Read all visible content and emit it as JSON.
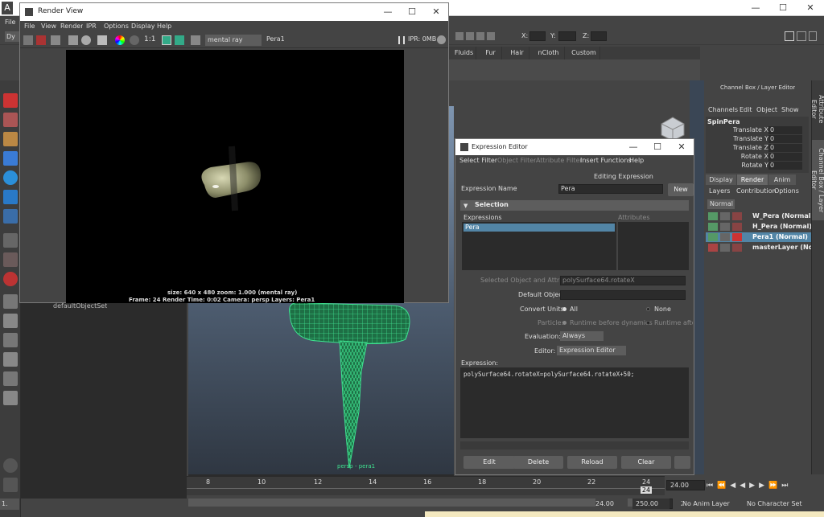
{
  "main_app": {
    "title_initial": "A",
    "menu_item": "File",
    "mode_menu": "Dy",
    "xyz": {
      "x_label": "X:",
      "y_label": "Y:",
      "z_label": "Z:"
    },
    "shelf_tabs": [
      "Fluids",
      "Fur",
      "Hair",
      "nCloth",
      "Custom"
    ],
    "outliner_item": "defaultObjectSet",
    "viewport_camera_label": "persp - pera1",
    "side_tabs": [
      "Attribute Editor",
      "Channel Box / Layer Editor"
    ]
  },
  "channel_box": {
    "title": "Channel Box / Layer Editor",
    "menu": [
      "Channels",
      "Edit",
      "Object",
      "Show"
    ],
    "object_name": "SpinPera",
    "attributes": [
      {
        "name": "Translate X",
        "value": "0"
      },
      {
        "name": "Translate Y",
        "value": "0"
      },
      {
        "name": "Translate Z",
        "value": "0"
      },
      {
        "name": "Rotate X",
        "value": "0"
      },
      {
        "name": "Rotate Y",
        "value": "0"
      }
    ],
    "layer_tabs": [
      "Display",
      "Render",
      "Anim"
    ],
    "layer_menu": [
      "Layers",
      "Contribution",
      "Options"
    ],
    "blend_mode": "Normal",
    "layers": [
      {
        "name": "W_Pera (Normal)",
        "selected": false
      },
      {
        "name": "H_Pera (Normal)",
        "selected": false
      },
      {
        "name": "Pera1 (Normal)",
        "selected": true
      },
      {
        "name": "masterLayer (Norm",
        "selected": false
      }
    ]
  },
  "timeline": {
    "ticks": [
      "8",
      "10",
      "12",
      "14",
      "16",
      "18",
      "20",
      "22",
      "24"
    ],
    "current_frame_marker": "24",
    "current_frame_box": "24.00",
    "range_start": "24.00",
    "range_end": "250.00",
    "anim_layer": "No Anim Layer",
    "character_set": "No Character Set",
    "left_field": "1."
  },
  "render_view": {
    "title": "Render View",
    "menu": [
      "File",
      "View",
      "Render",
      "IPR",
      "Options",
      "Display",
      "Help"
    ],
    "ratio_label": "1:1",
    "renderer": "mental ray",
    "layer": "Pera1",
    "ipr_status": "IPR: 0MB",
    "info_line1": "size: 640 x 480  zoom: 1.000          (mental ray)",
    "info_line2": "Frame: 24       Render Time: 0:02       Camera: persp       Layers: Pera1"
  },
  "expression_editor": {
    "title": "Expression Editor",
    "menu": [
      "Select Filter",
      "Object Filter",
      "Attribute Filter",
      "Insert Functions",
      "Help"
    ],
    "heading": "Editing Expression",
    "name_label": "Expression Name",
    "name_value": "Pera",
    "new_button": "New",
    "selection_header": "Selection",
    "expressions_col": "Expressions",
    "attributes_col": "Attributes",
    "expression_items": [
      "Pera"
    ],
    "selected_obj_label": "Selected Object and Attribute:",
    "selected_obj_value": "polySurface64.rotateX",
    "default_obj_label": "Default Object:",
    "default_obj_value": "",
    "convert_units_label": "Convert Units:",
    "convert_all": "All",
    "convert_none": "None",
    "particle_label": "Particle:",
    "particle_before": "Runtime before dynamics",
    "particle_after": "Runtime after",
    "evaluation_label": "Evaluation:",
    "evaluation_value": "Always",
    "editor_label": "Editor:",
    "editor_value": "Expression Editor",
    "expression_label": "Expression:",
    "expression_text": "polySurface64.rotateX=polySurface64.rotateX+50;",
    "buttons": [
      "Edit",
      "Delete",
      "Reload",
      "Clear"
    ]
  },
  "window_controls": {
    "minimize": "—",
    "maximize": "☐",
    "close": "✕"
  },
  "colors": {
    "accent_selected": "#5285a6",
    "mesh_green": "#3ee08f",
    "viewport_top": "#7e95b0"
  }
}
